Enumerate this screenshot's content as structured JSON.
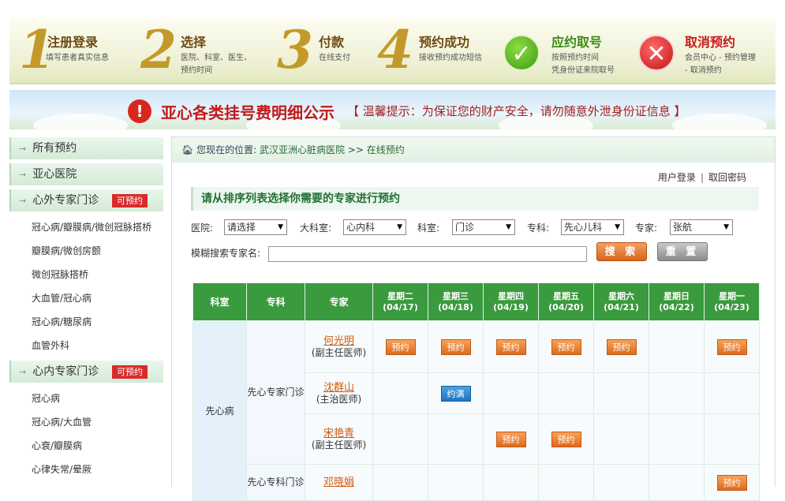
{
  "steps": [
    {
      "num": "1",
      "title": "注册登录",
      "desc": [
        "填写患者真实信息"
      ]
    },
    {
      "num": "2",
      "title": "选择",
      "desc": [
        "医院、科室、医生、",
        "预约时间"
      ]
    },
    {
      "num": "3",
      "title": "付款",
      "desc": [
        "在线支付"
      ]
    },
    {
      "num": "4",
      "title": "预约成功",
      "desc": [
        "接收预约成功短信"
      ]
    },
    {
      "title": "应约取号",
      "desc": [
        "按照预约时间",
        "凭身份证来院取号"
      ]
    },
    {
      "title": "取消预约",
      "desc": [
        "会员中心 - 预约管理",
        "- 取消预约"
      ]
    }
  ],
  "notice": {
    "title": "亚心各类挂号费明细公示",
    "tip": "【 温馨提示：为保证您的财产安全，请勿随意外泄身份证信息 】"
  },
  "sidebar": {
    "menu1": "所有预约",
    "menu2": "亚心医院",
    "menu3": "心外专家门诊",
    "menu3_tag": "可预约",
    "surgery_items": [
      "冠心病/瓣膜病/微创冠脉搭桥",
      "瓣膜病/微创房颤",
      "微创冠脉搭桥",
      "大血管/冠心病",
      "冠心病/糖尿病",
      "血管外科"
    ],
    "menu4": "心内专家门诊",
    "menu4_tag": "可预约",
    "internal_items": [
      "冠心病",
      "冠心病/大血管",
      "心衰/瓣膜病",
      "心律失常/晕厥"
    ]
  },
  "breadcrumb": {
    "prefix": "您现在的位置:",
    "hospital": "武汉亚洲心脏病医院",
    "sep": ">>",
    "current": "在线预约"
  },
  "user_links": {
    "login": "用户登录",
    "sep": "|",
    "password": "取回密码"
  },
  "section_title": "请从排序列表选择你需要的专家进行预约",
  "filters": {
    "hospital_label": "医院:",
    "hospital_value": "请选择",
    "dept_label": "大科室:",
    "dept_value": "心内科",
    "office_label": "科室:",
    "office_value": "门诊",
    "specialty_label": "专科:",
    "specialty_value": "先心儿科",
    "expert_label": "专家:",
    "expert_value": "张航",
    "fuzzy_label": "模糊搜索专家名:",
    "fuzzy_value": "",
    "search_btn": "搜 索",
    "reset_btn": "重 置"
  },
  "table": {
    "headers": {
      "dept": "科室",
      "specialty": "专科",
      "expert": "专家"
    },
    "days": [
      {
        "name": "星期二",
        "date": "(04/17)"
      },
      {
        "name": "星期三",
        "date": "(04/18)"
      },
      {
        "name": "星期四",
        "date": "(04/19)"
      },
      {
        "name": "星期五",
        "date": "(04/20)"
      },
      {
        "name": "星期六",
        "date": "(04/21)"
      },
      {
        "name": "星期日",
        "date": "(04/22)"
      },
      {
        "name": "星期一",
        "date": "(04/23)"
      }
    ],
    "dept": "先心病",
    "spec1": "先心专家门诊",
    "spec2": "先心专科门诊",
    "rows": [
      {
        "name": "何光明",
        "title": "(副主任医师)"
      },
      {
        "name": "沈群山",
        "title": "(主治医师)"
      },
      {
        "name": "宋艳青",
        "title": "(副主任医师)"
      },
      {
        "name": "邓晓娟",
        "title": ""
      }
    ],
    "book_label": "预约",
    "full_label": "约满"
  }
}
